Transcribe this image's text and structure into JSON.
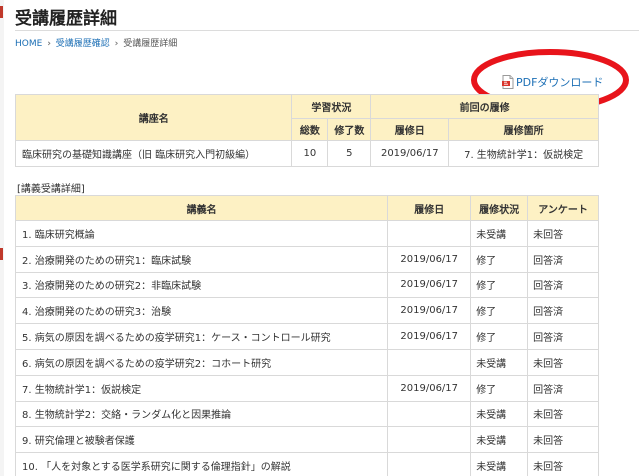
{
  "page": {
    "title": "受講履歴詳細"
  },
  "breadcrumb": [
    {
      "label": "HOME",
      "link": true
    },
    {
      "label": "受講履歴確認",
      "link": true
    },
    {
      "label": "受講履歴詳細",
      "link": false
    }
  ],
  "breadcrumb_separator": "›",
  "pdf_download": {
    "label": "PDFダウンロード",
    "icon": "pdf-file-icon"
  },
  "annotation_color": "#e8141b",
  "summary": {
    "headers": {
      "course": "講座名",
      "progress": "学習状況",
      "total": "総数",
      "completed": "修了数",
      "last_session": "前回の履修",
      "date": "履修日",
      "section": "履修箇所"
    },
    "row": {
      "course": "臨床研究の基礎知識講座（旧 臨床研究入門初級編）",
      "total": "10",
      "completed": "5",
      "date": "2019/06/17",
      "section": "7. 生物統計学1：仮説検定"
    }
  },
  "lectures": {
    "section_label": "[講義受講詳細]",
    "headers": {
      "name": "講義名",
      "date": "履修日",
      "status": "履修状況",
      "survey": "アンケート"
    },
    "rows": [
      {
        "name": "1. 臨床研究概論",
        "date": "",
        "status": "未受講",
        "survey": "未回答"
      },
      {
        "name": "2. 治療開発のための研究1：臨床試験",
        "date": "2019/06/17",
        "status": "修了",
        "survey": "回答済"
      },
      {
        "name": "3. 治療開発のための研究2：非臨床試験",
        "date": "2019/06/17",
        "status": "修了",
        "survey": "回答済"
      },
      {
        "name": "4. 治療開発のための研究3：治験",
        "date": "2019/06/17",
        "status": "修了",
        "survey": "回答済"
      },
      {
        "name": "5. 病気の原因を調べるための疫学研究1：ケース・コントロール研究",
        "date": "2019/06/17",
        "status": "修了",
        "survey": "回答済"
      },
      {
        "name": "6. 病気の原因を調べるための疫学研究2：コホート研究",
        "date": "",
        "status": "未受講",
        "survey": "未回答"
      },
      {
        "name": "7. 生物統計学1：仮説検定",
        "date": "2019/06/17",
        "status": "修了",
        "survey": "回答済"
      },
      {
        "name": "8. 生物統計学2：交絡・ランダム化と因果推論",
        "date": "",
        "status": "未受講",
        "survey": "未回答"
      },
      {
        "name": "9. 研究倫理と被験者保護",
        "date": "",
        "status": "未受講",
        "survey": "未回答"
      },
      {
        "name": "10. 「人を対象とする医学系研究に関する倫理指針」の解説",
        "date": "",
        "status": "未受講",
        "survey": "未回答"
      }
    ]
  }
}
